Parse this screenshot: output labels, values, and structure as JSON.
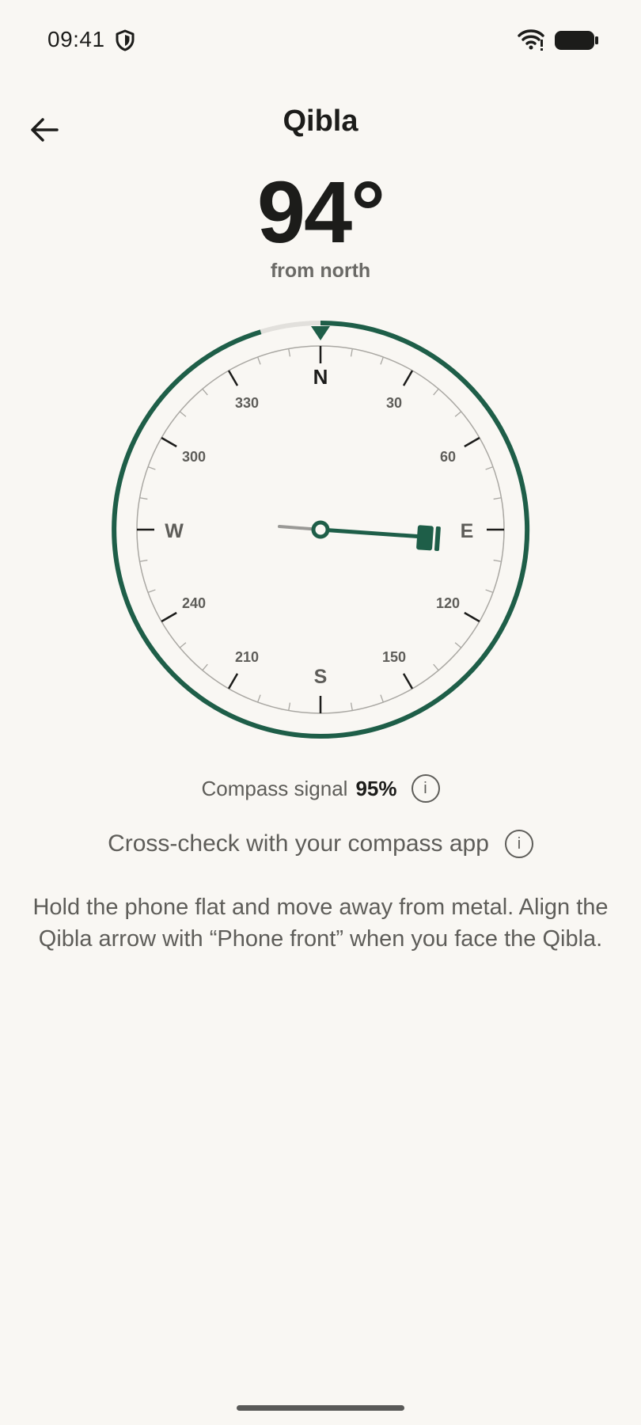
{
  "status_bar": {
    "time": "09:41",
    "icons": [
      "shield-icon",
      "wifi-icon",
      "battery-icon"
    ]
  },
  "header": {
    "title": "Qibla",
    "back_icon": "arrow-left-icon"
  },
  "heading": {
    "degrees": "94°",
    "label": "from north"
  },
  "compass": {
    "cardinals": {
      "n": "N",
      "e": "E",
      "s": "S",
      "w": "W"
    },
    "ticks": {
      "t30": "30",
      "t60": "60",
      "t120": "120",
      "t150": "150",
      "t210": "210",
      "t240": "240",
      "t300": "300",
      "t330": "330"
    },
    "qibla_bearing_deg": 94,
    "colors": {
      "accent": "#1e5e48",
      "ring_track": "#e2e0dc",
      "text": "#1c1c1a"
    }
  },
  "signal": {
    "label": "Compass signal",
    "value": "95%",
    "info_icon": "info-icon"
  },
  "crosscheck": {
    "label": "Cross-check with your compass app",
    "info_icon": "info-icon"
  },
  "hint": "Hold the phone flat and move away from metal. Align the Qibla arrow with “Phone front” when you face the Qibla."
}
